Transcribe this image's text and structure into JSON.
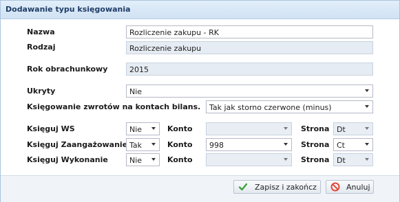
{
  "title": "Dodawanie typu księgowania",
  "labels": {
    "nazwa": "Nazwa",
    "rodzaj": "Rodzaj",
    "rok": "Rok obrachunkowy",
    "ukryty": "Ukryty",
    "ksiegowanie": "Księgowanie zwrotów na kontach bilans.",
    "ws": "Księguj WS",
    "zaang": "Księguj Zaangażowanie",
    "wyk": "Księguj Wykonanie",
    "konto": "Konto",
    "strona": "Strona"
  },
  "values": {
    "nazwa": "Rozliczenie zakupu - RK",
    "rodzaj": "Rozliczenie zakupu",
    "rok": "2015",
    "ukryty": "Nie",
    "ksiegowanie": "Tak jak storno czerwone (minus)"
  },
  "rows": {
    "ws": {
      "flag": "Nie",
      "konto": "",
      "strona": "Dt"
    },
    "zaang": {
      "flag": "Tak",
      "konto": "998",
      "strona": "Ct"
    },
    "wyk": {
      "flag": "Nie",
      "konto": "",
      "strona": "Dt"
    }
  },
  "buttons": {
    "save": "Zapisz i zakończ",
    "cancel": "Anuluj"
  },
  "icons": {
    "save": "checkmark-icon",
    "cancel": "cancel-icon"
  },
  "colors": {
    "title_bg": "#d6e6f6",
    "readonly_bg": "#e6ecf3",
    "footer_bg": "#f0f3f7",
    "save_icon": "#3fa33a",
    "cancel_icon": "#e3483a"
  }
}
